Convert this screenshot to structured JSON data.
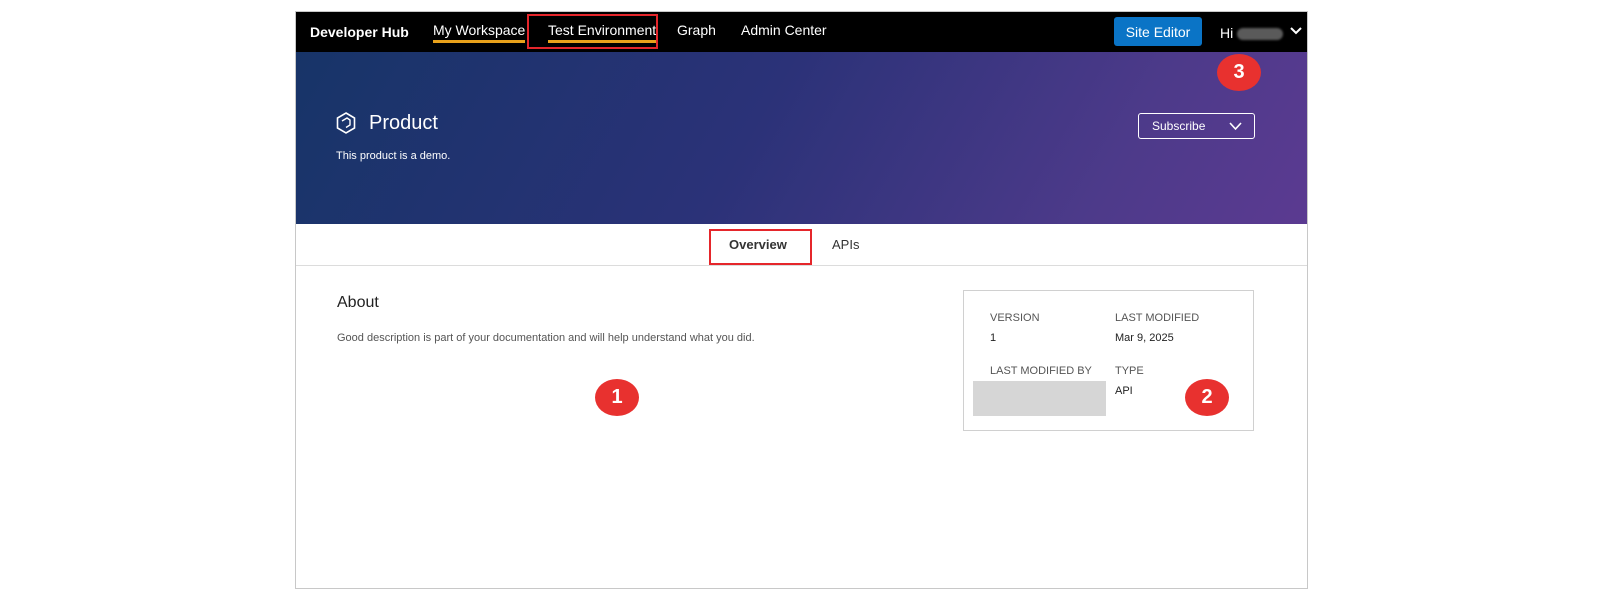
{
  "header": {
    "brand": "Developer Hub",
    "nav": [
      "My Workspace",
      "Test Environment",
      "Graph",
      "Admin Center"
    ],
    "site_editor": "Site Editor",
    "greeting": "Hi",
    "accent_color": "#e9a21b",
    "button_color": "#0a74c6"
  },
  "hero": {
    "icon": "product-cube-icon",
    "title": "Product",
    "description": "This product is a demo.",
    "subscribe": "Subscribe"
  },
  "tabs": [
    "Overview",
    "APIs"
  ],
  "about": {
    "title": "About",
    "text": "Good description is part of your documentation and will help understand what you did."
  },
  "info": {
    "version_label": "VERSION",
    "version": "1",
    "last_modified_label": "LAST MODIFIED",
    "last_modified": "Mar 9, 2025",
    "last_modified_by_label": "LAST MODIFIED BY",
    "type_label": "TYPE",
    "type": "API"
  },
  "callouts": [
    "1",
    "2",
    "3"
  ],
  "highlight_color": "#e5262b",
  "callout_color": "#e8312f"
}
